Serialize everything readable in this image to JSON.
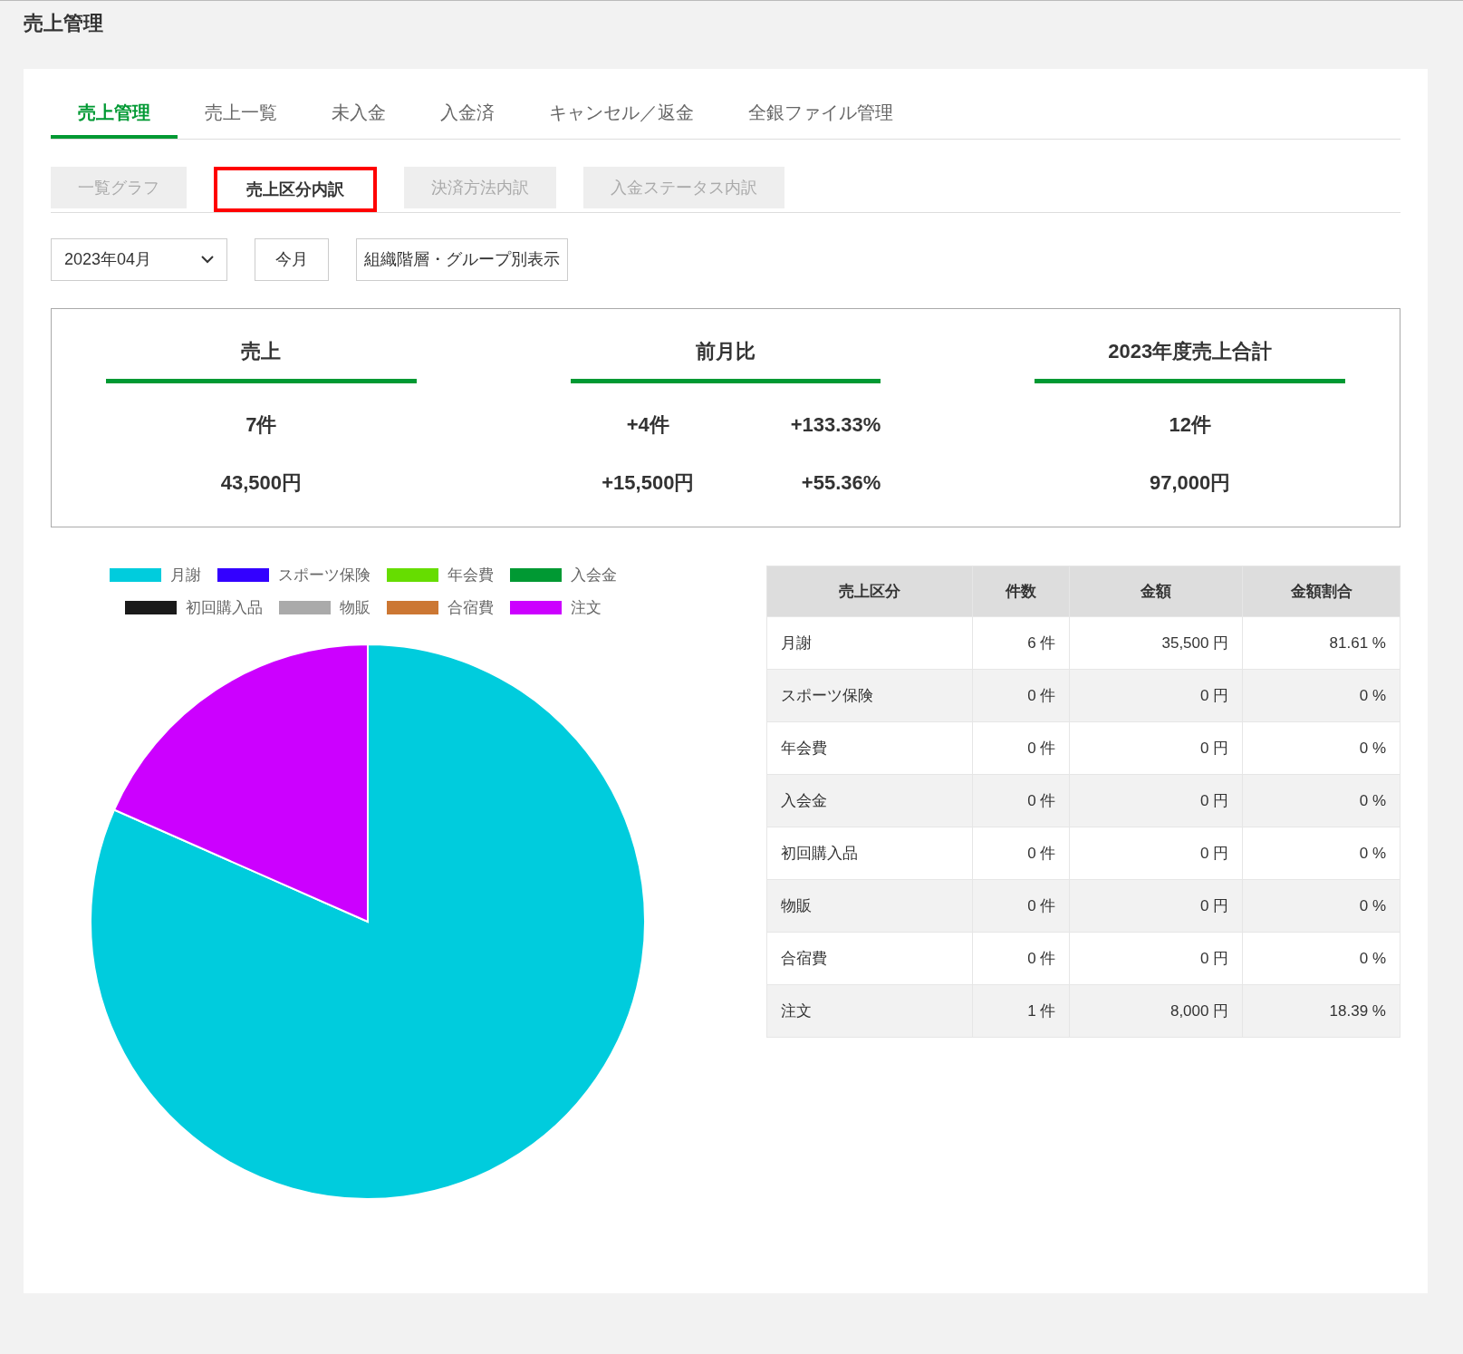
{
  "page_title": "売上管理",
  "tabs": [
    {
      "label": "売上管理",
      "selected": true
    },
    {
      "label": "売上一覧",
      "selected": false
    },
    {
      "label": "未入金",
      "selected": false
    },
    {
      "label": "入金済",
      "selected": false
    },
    {
      "label": "キャンセル／返金",
      "selected": false
    },
    {
      "label": "全銀ファイル管理",
      "selected": false
    }
  ],
  "sub_tabs": [
    {
      "label": "一覧グラフ",
      "selected": false
    },
    {
      "label": "売上区分内訳",
      "selected": true
    },
    {
      "label": "決済方法内訳",
      "selected": false
    },
    {
      "label": "入金ステータス内訳",
      "selected": false
    }
  ],
  "month_select": {
    "value": "2023年04月"
  },
  "buttons": [
    "今月",
    "組織階層・グループ別表示"
  ],
  "summary": [
    {
      "title": "売上",
      "rows": [
        [
          "7件"
        ],
        [
          "43,500円"
        ]
      ]
    },
    {
      "title": "前月比",
      "rows": [
        [
          "+4件",
          "+133.33%"
        ],
        [
          "+15,500円",
          "+55.36%"
        ]
      ]
    },
    {
      "title": "2023年度売上合計",
      "rows": [
        [
          "12件"
        ],
        [
          "97,000円"
        ]
      ]
    }
  ],
  "chart_data": {
    "type": "pie",
    "categories": [
      "月謝",
      "スポーツ保険",
      "年会費",
      "入会金",
      "初回購入品",
      "物販",
      "合宿費",
      "注文"
    ],
    "values": [
      81.61,
      0,
      0,
      0,
      0,
      0,
      0,
      18.39
    ],
    "legend": "top",
    "colors": [
      "#00ccdd",
      "#3300ff",
      "#66dd00",
      "#009933",
      "#1a1a1a",
      "#aaaaaa",
      "#cc7733",
      "#cc00ff"
    ]
  },
  "table": {
    "columns": [
      "売上区分",
      "件数",
      "金額",
      "金額割合"
    ],
    "rows": [
      [
        "月謝",
        "6 件",
        "35,500 円",
        "81.61 %"
      ],
      [
        "スポーツ保険",
        "0 件",
        "0 円",
        "0 %"
      ],
      [
        "年会費",
        "0 件",
        "0 円",
        "0 %"
      ],
      [
        "入会金",
        "0 件",
        "0 円",
        "0 %"
      ],
      [
        "初回購入品",
        "0 件",
        "0 円",
        "0 %"
      ],
      [
        "物販",
        "0 件",
        "0 円",
        "0 %"
      ],
      [
        "合宿費",
        "0 件",
        "0 円",
        "0 %"
      ],
      [
        "注文",
        "1 件",
        "8,000 円",
        "18.39 %"
      ]
    ]
  }
}
